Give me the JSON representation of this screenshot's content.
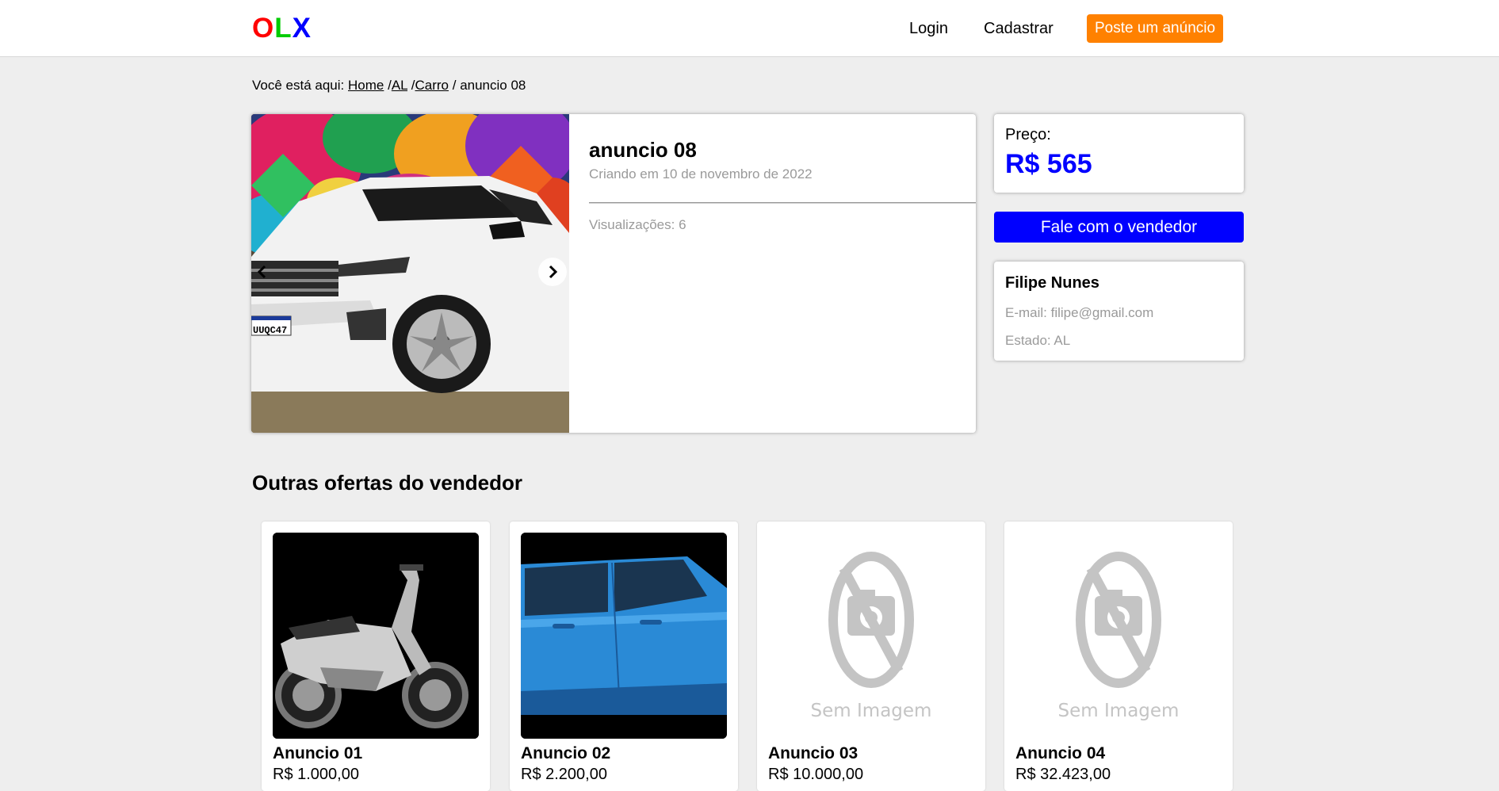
{
  "header": {
    "logo": {
      "o": "O",
      "l": "L",
      "x": "X",
      "colors": {
        "o": "#ff0000",
        "l": "#00cc00",
        "x": "#0000ff"
      }
    },
    "login": "Login",
    "register": "Cadastrar",
    "post_ad": "Poste um anúncio"
  },
  "breadcrumb": {
    "prefix": "Você está aqui:",
    "home": "Home",
    "sep1": "/",
    "state": "AL",
    "sep2": "/",
    "category": "Carro",
    "sep3": "/",
    "current": "anuncio 08"
  },
  "ad": {
    "title": "anuncio 08",
    "created": "Criando em 10 de novembro de 2022",
    "views": "Visualizações: 6",
    "plate": "UUQC47",
    "icons": {
      "prev": "chevron-left-icon",
      "next": "chevron-right-icon"
    }
  },
  "price": {
    "label": "Preço:",
    "value": "R$ 565",
    "color": "#0000ff"
  },
  "contact_button": "Fale com o vendedor",
  "seller": {
    "name": "Filipe Nunes",
    "email": "E-mail: filipe@gmail.com",
    "state": "Estado: AL"
  },
  "other_offers": {
    "title": "Outras ofertas do vendedor",
    "no_image_text": "Sem Imagem",
    "items": [
      {
        "title": "Anuncio 01",
        "price": "R$ 1.000,00",
        "image": "motorcycle"
      },
      {
        "title": "Anuncio 02",
        "price": "R$ 2.200,00",
        "image": "blue-car"
      },
      {
        "title": "Anuncio 03",
        "price": "R$ 10.000,00",
        "image": "no-image"
      },
      {
        "title": "Anuncio 04",
        "price": "R$ 32.423,00",
        "image": "no-image"
      }
    ]
  }
}
